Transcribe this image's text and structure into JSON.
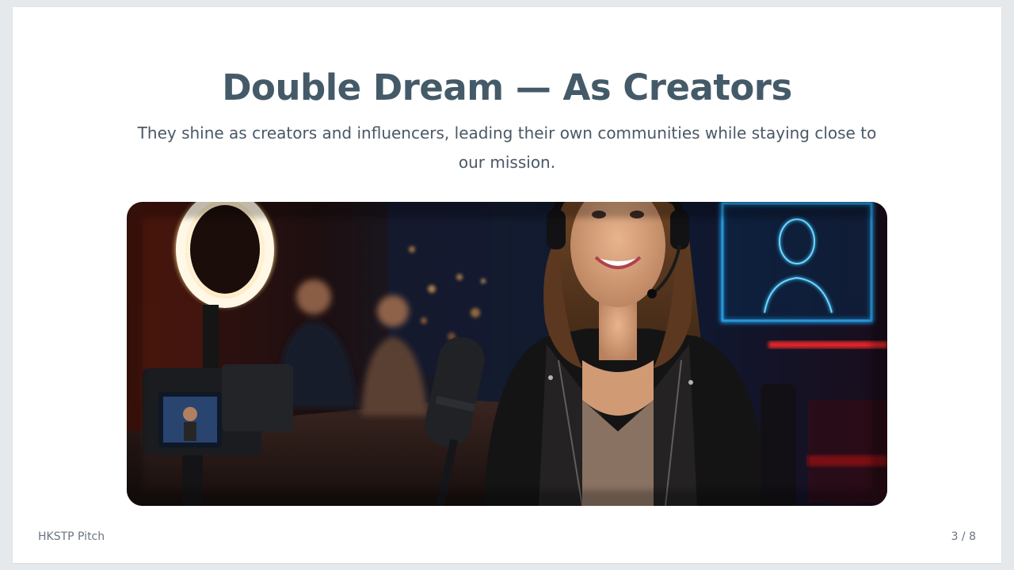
{
  "slide": {
    "title": "Double Dream — As Creators",
    "subtitle": "They shine as creators and influencers, leading their own communities while staying close to our mission.",
    "image_description_icon": "creator-studio-photo",
    "footer": {
      "deck_name": "HKSTP Pitch",
      "page_indicator": "3 / 8"
    }
  },
  "colors": {
    "title": "#445a69",
    "subtitle": "#4a5866",
    "footer": "#6b7480",
    "background": "#e6e9ec",
    "slide": "#ffffff"
  }
}
